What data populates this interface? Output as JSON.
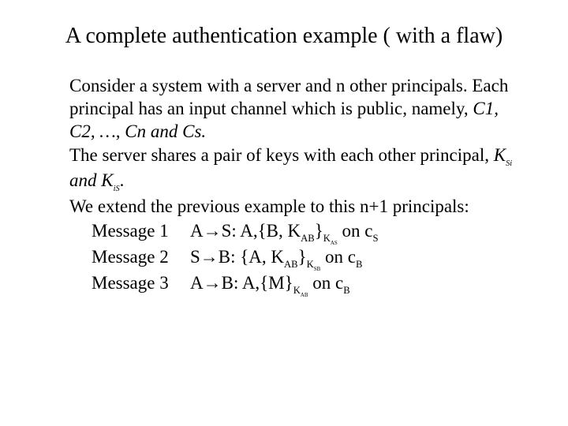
{
  "title": "A complete authentication example ( with a flaw)",
  "para1_a": "Consider a system with a server and n other principals. Each principal has an input channel which is public, namely, ",
  "para1_b": "C1, C2, …, Cn and Cs.",
  "para2_a": "The server shares a pair of keys with each other principal, ",
  "k1": "K",
  "k1_sub": "Si",
  "para2_b": " and ",
  "k2": "K",
  "k2_sub": "iS",
  "para2_c": ".",
  "para3": "We extend the previous example to this n+1 principals:",
  "messages": [
    {
      "label": "Message 1",
      "lhs": "A→S: A,{B, K",
      "sub1": "AB",
      "mid": "}",
      "keyK": "K",
      "sub2": "AS",
      "onc": " on c",
      "chan": "S"
    },
    {
      "label": "Message 2",
      "lhs": "S→B: {A, K",
      "sub1": "AB",
      "mid": "}",
      "keyK": "K",
      "sub2": "SB",
      "onc": " on c",
      "chan": "B"
    },
    {
      "label": "Message 3",
      "lhs": "A→B: A,{M}",
      "sub1": "",
      "mid": "",
      "keyK": "K",
      "sub2": "AB",
      "onc": " on c",
      "chan": "B"
    }
  ]
}
